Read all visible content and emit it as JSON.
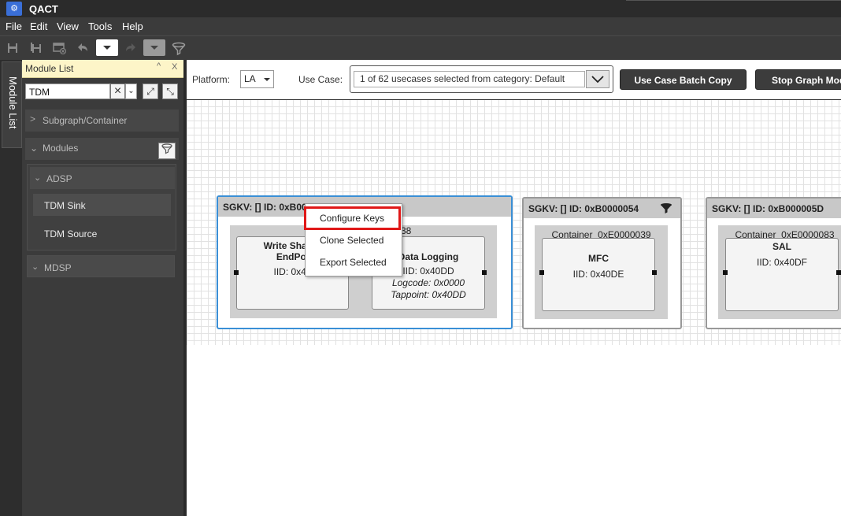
{
  "app": {
    "title": "QACT",
    "icon": "qact-app-icon"
  },
  "menu": [
    "File",
    "Edit",
    "View",
    "Tools",
    "Help"
  ],
  "toolbar": {
    "icons": [
      "save-icon",
      "save-all-icon",
      "close-doc-icon",
      "undo-icon",
      "redo-icon",
      "filter-icon"
    ]
  },
  "left_strip": {
    "tab_label": "Module List"
  },
  "module_list": {
    "title": "Module List",
    "search_value": "TDM",
    "sections": {
      "subgraph": "Subgraph/Container",
      "modules": "Modules",
      "adsp": "ADSP",
      "mdsp": "MDSP"
    },
    "items": [
      "TDM Sink",
      "TDM Source"
    ]
  },
  "config": {
    "platform_label": "Platform:",
    "platform_value": "LA",
    "usecase_label": "Use Case:",
    "usecase_value": "1 of 62 usecases selected from category: Default",
    "batch_copy": "Use Case Batch Copy",
    "stop_graph": "Stop Graph Mod"
  },
  "graph": {
    "sg1": {
      "header": "SGKV: [] ID: 0xB0000026",
      "container_suffix": "38",
      "module_a": {
        "title_line1": "Write Shared",
        "title_line2": "EndPoi",
        "iid": "IID: 0x40"
      },
      "module_b": {
        "title": "Data Logging",
        "iid": "IID: 0x40DD",
        "logcode": "Logcode: 0x0000",
        "tappoint": "Tappoint: 0x40DD"
      }
    },
    "sg2": {
      "header": "SGKV: [] ID: 0xB0000054",
      "container": "Container_0xE0000039",
      "module": {
        "title": "MFC",
        "iid": "IID: 0x40DE"
      }
    },
    "sg3": {
      "header": "SGKV: [] ID: 0xB000005D",
      "container": "Container_0xE0000083",
      "module": {
        "title": "SAL",
        "iid": "IID: 0x40DF"
      }
    }
  },
  "context_menu": {
    "items": [
      "Configure Keys",
      "Clone Selected",
      "Export Selected"
    ],
    "highlighted": "Configure Keys"
  },
  "colors": {
    "selection": "#3a8fd6",
    "highlight": "#e01818"
  }
}
